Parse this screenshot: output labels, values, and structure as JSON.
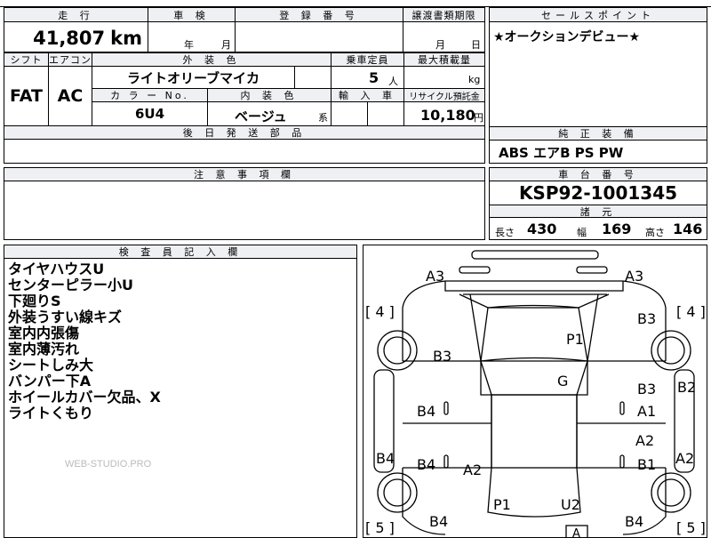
{
  "top": {
    "mileage_hdr": "走 行",
    "inspection_hdr": "車 検",
    "reg_hdr": "登 録 番 号",
    "transfer_hdr": "譲渡書類期限",
    "sales_hdr": "セールスポイント",
    "mileage": "41,807",
    "mileage_unit": "km",
    "year_unit": "年",
    "month_unit": "月",
    "month_unit2": "月",
    "day_unit": "日",
    "sales_point": "★オークションデビュー★"
  },
  "spec": {
    "shift_hdr": "シフト",
    "ac_hdr": "エアコン",
    "ext_color_hdr": "外 装 色",
    "capacity_hdr": "乗車定員",
    "max_load_hdr": "最大積載量",
    "shift": "FAT",
    "ac": "AC",
    "ext_color": "ライトオリーブマイカ",
    "capacity": "5",
    "capacity_unit": "人",
    "load_unit": "kg",
    "color_no_hdr": "カ ラ ー No.",
    "int_color_hdr": "内 装 色",
    "import_hdr": "輸 入 車",
    "recycle_hdr": "リサイクル預託金",
    "color_no": "6U4",
    "int_color": "ベージュ",
    "int_suffix": "系",
    "recycle": "10,180",
    "recycle_unit": "円",
    "later_parts_hdr": "後 日 発 送 部 品"
  },
  "equipment": {
    "hdr": "純 正 装 備",
    "items": "ABS エアB PS PW"
  },
  "caution": {
    "hdr": "注 意 事 項 欄"
  },
  "chassis": {
    "hdr": "車 台 番 号",
    "number": "KSP92-1001345",
    "dims_hdr": "諸 元",
    "length_label": "長さ",
    "length": "430",
    "width_label": "幅",
    "width": "169",
    "height_label": "高さ",
    "height": "146"
  },
  "inspector": {
    "hdr": "検 査 員 記 入 欄",
    "notes": [
      "タイヤハウスU",
      "センターピラー小U",
      "下廻りS",
      "外装うすい線キズ",
      "室内内張傷",
      "室内薄汚れ",
      "シートしみ大",
      "バンパー下A",
      "ホイールカバー欠品、X",
      "ライトくもり"
    ]
  },
  "watermark": "WEB-STUDIO.PRO",
  "diagram": {
    "labels": [
      "A3",
      "A3",
      "[ 4 ]",
      "[ 4 ]",
      "B3",
      "P1",
      "B3",
      "G",
      "B3",
      "B2",
      "B4",
      "A1",
      "A2",
      "B4",
      "B4",
      "B1",
      "A2",
      "A2",
      "P1",
      "U2",
      "B4",
      "B4",
      "[ 5 ]",
      "[ 5 ]",
      "A"
    ]
  }
}
